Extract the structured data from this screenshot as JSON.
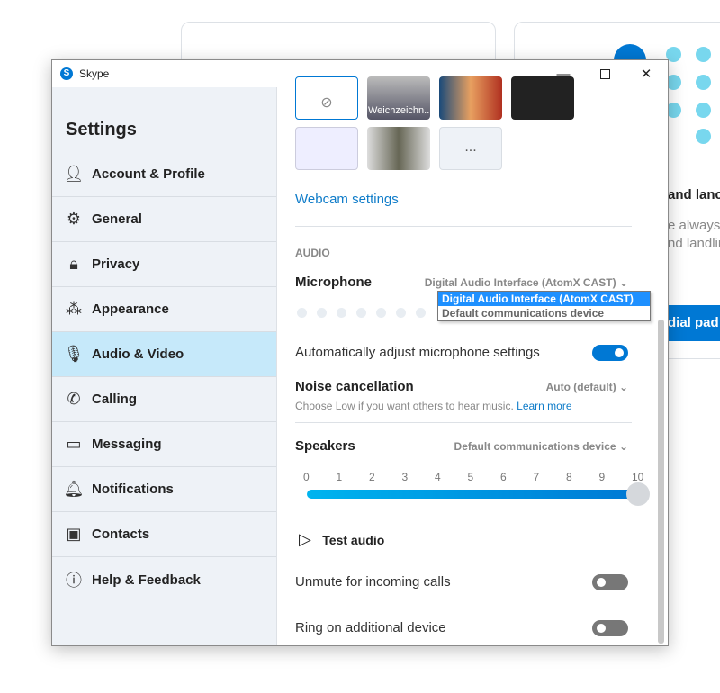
{
  "background": {
    "heading_fragment": "and lanc",
    "line1": "e always",
    "line2": "nd landlin",
    "button": "dial pad"
  },
  "window": {
    "title": "Skype",
    "controls": [
      "minimize-icon",
      "maximize-icon",
      "close-icon"
    ]
  },
  "sidebar": {
    "title": "Settings",
    "active": "Audio & Video",
    "items": [
      {
        "label": "Account & Profile",
        "icon": "person-icon"
      },
      {
        "label": "General",
        "icon": "gear-icon"
      },
      {
        "label": "Privacy",
        "icon": "lock-icon"
      },
      {
        "label": "Appearance",
        "icon": "magic-wand-icon"
      },
      {
        "label": "Audio & Video",
        "icon": "microphone-icon"
      },
      {
        "label": "Calling",
        "icon": "phone-icon"
      },
      {
        "label": "Messaging",
        "icon": "chat-icon"
      },
      {
        "label": "Notifications",
        "icon": "bell-icon"
      },
      {
        "label": "Contacts",
        "icon": "contacts-icon"
      },
      {
        "label": "Help & Feedback",
        "icon": "info-icon"
      }
    ]
  },
  "video": {
    "blur_label": "Weichzeichn...",
    "more_label": "...",
    "webcam_settings": "Webcam settings"
  },
  "audio": {
    "section": "AUDIO",
    "microphone": {
      "label": "Microphone",
      "selected": "Digital Audio Interface (AtomX CAST)",
      "options": [
        "Digital Audio Interface (AtomX CAST)",
        "Default communications device"
      ]
    },
    "auto_adjust": {
      "label": "Automatically adjust microphone settings",
      "on": true
    },
    "noise": {
      "label": "Noise cancellation",
      "value": "Auto (default)",
      "hint": "Choose Low if you want others to hear music.",
      "learn_more": "Learn more"
    },
    "speakers": {
      "label": "Speakers",
      "value": "Default communications device",
      "ticks": [
        "0",
        "1",
        "2",
        "3",
        "4",
        "5",
        "6",
        "7",
        "8",
        "9",
        "10"
      ],
      "volume": 10,
      "volume_max": 10
    },
    "test_audio": "Test audio",
    "unmute": {
      "label": "Unmute for incoming calls",
      "on": false
    },
    "ring": {
      "label": "Ring on additional device",
      "on": false
    }
  },
  "colors": {
    "accent": "#0078d4",
    "active_item": "#c6e9fa",
    "sidebar": "#eef2f7"
  }
}
